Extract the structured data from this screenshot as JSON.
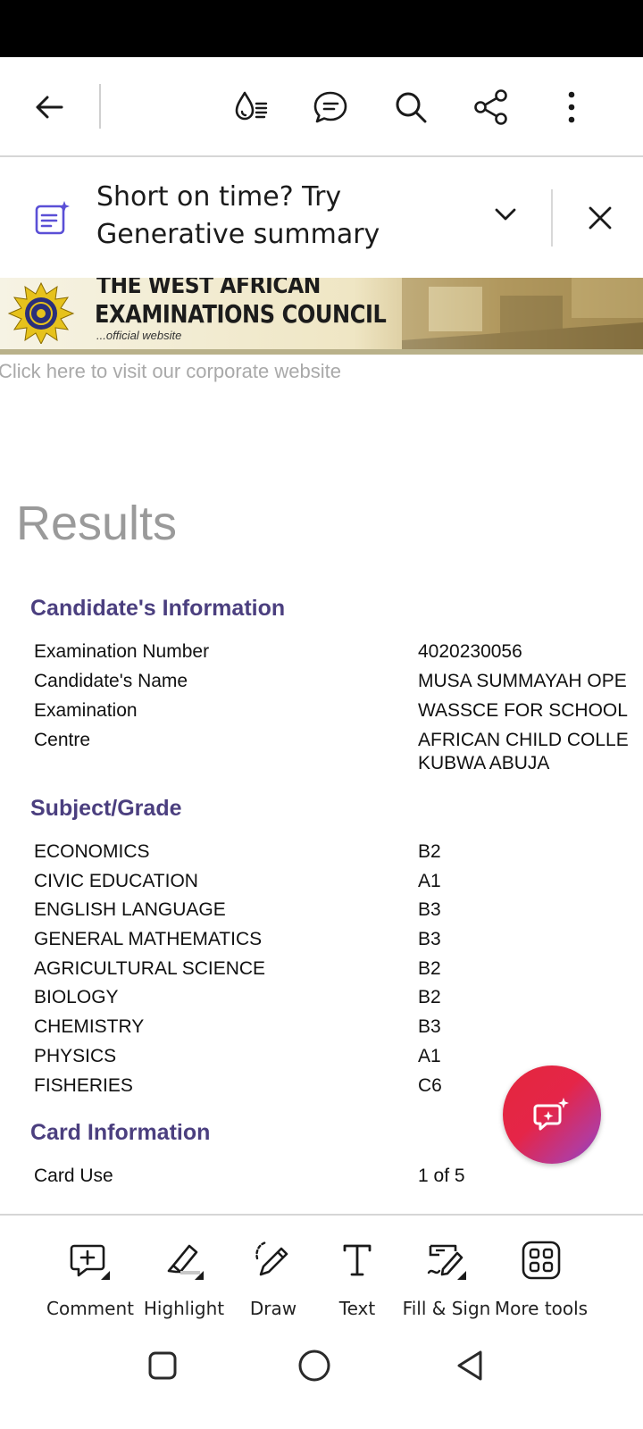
{
  "banner": {
    "text": "Short on time? Try Generative summary"
  },
  "document": {
    "header": {
      "title_line1": "THE WEST AFRICAN",
      "title_line2": "EXAMINATIONS COUNCIL",
      "subtitle": "...official website"
    },
    "corporate_link": "Click here to visit our corporate website",
    "results_heading": "Results",
    "candidate_section": {
      "heading": "Candidate's Information",
      "rows": [
        {
          "label": "Examination Number",
          "value": "4020230056"
        },
        {
          "label": "Candidate's Name",
          "value": "MUSA SUMMAYAH OPE"
        },
        {
          "label": "Examination",
          "value": "WASSCE FOR SCHOOL"
        },
        {
          "label": "Centre",
          "value": "AFRICAN CHILD COLLE",
          "value2": "KUBWA ABUJA"
        }
      ]
    },
    "grades_section": {
      "heading": "Subject/Grade",
      "rows": [
        {
          "subject": "ECONOMICS",
          "grade": "B2"
        },
        {
          "subject": "CIVIC EDUCATION",
          "grade": "A1"
        },
        {
          "subject": "ENGLISH LANGUAGE",
          "grade": "B3"
        },
        {
          "subject": "GENERAL MATHEMATICS",
          "grade": "B3"
        },
        {
          "subject": "AGRICULTURAL SCIENCE",
          "grade": "B2"
        },
        {
          "subject": "BIOLOGY",
          "grade": "B2"
        },
        {
          "subject": "CHEMISTRY",
          "grade": "B3"
        },
        {
          "subject": "PHYSICS",
          "grade": "A1"
        },
        {
          "subject": "FISHERIES",
          "grade": "C6"
        }
      ]
    },
    "card_section": {
      "heading": "Card Information",
      "rows": [
        {
          "label": "Card Use",
          "value": "1 of 5"
        }
      ]
    }
  },
  "bottom_tools": [
    {
      "label": "Comment",
      "icon": "comment-plus-icon"
    },
    {
      "label": "Highlight",
      "icon": "highlighter-icon"
    },
    {
      "label": "Draw",
      "icon": "pencil-draw-icon"
    },
    {
      "label": "Text",
      "icon": "text-t-icon"
    },
    {
      "label": "Fill & Sign",
      "icon": "fill-sign-icon"
    },
    {
      "label": "More tools",
      "icon": "grid-icon"
    }
  ],
  "colors": {
    "section_heading": "#4b3f7f",
    "muted_text": "#9a9a9a",
    "fab_gradient_start": "#e3273d",
    "fab_gradient_end": "#7d3fd0",
    "genai_icon": "#5a4fd6"
  }
}
